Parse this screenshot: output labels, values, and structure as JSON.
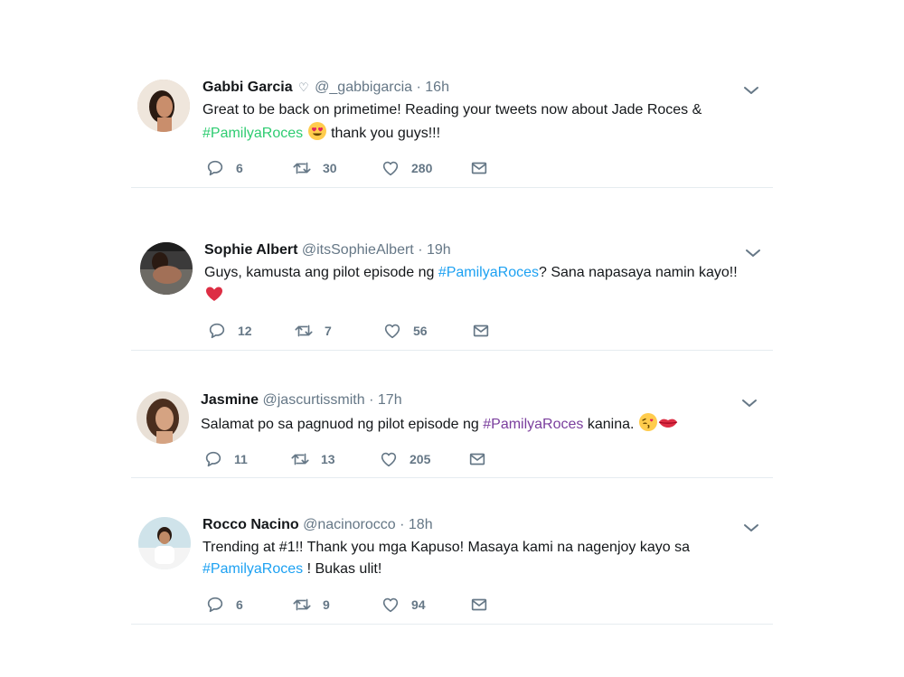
{
  "tweets": [
    {
      "name": "Gabbi Garcia",
      "verified_heart": "♡",
      "handle": "@_gabbigarcia",
      "time": "16h",
      "line1": "Great to be back on primetime! Reading your tweets now about Jade Roces &",
      "hashtag": "#PamilyaRoces",
      "after": "thank you guys!!!",
      "replies": "6",
      "retweets": "30",
      "likes": "280"
    },
    {
      "name": "Sophie Albert",
      "handle": "@itsSophieAlbert",
      "time": "19h",
      "before": "Guys, kamusta ang pilot episode ng",
      "hashtag": "#PamilyaRoces",
      "after": "? Sana napasaya namin kayo!!",
      "replies": "12",
      "retweets": "7",
      "likes": "56"
    },
    {
      "name": "Jasmine",
      "handle": "@jascurtissmith",
      "time": "17h",
      "before": "Salamat po sa pagnuod ng pilot episode ng",
      "hashtag": "#PamilyaRoces",
      "after": "kanina.",
      "replies": "11",
      "retweets": "13",
      "likes": "205"
    },
    {
      "name": "Rocco Nacino",
      "handle": "@nacinorocco",
      "time": "18h",
      "line1": "Trending at #1!! Thank you mga Kapuso! Masaya kami na nagenjoy kayo sa",
      "hashtag": "#PamilyaRoces",
      "after": "! Bukas ulit!",
      "replies": "6",
      "retweets": "9",
      "likes": "94"
    }
  ],
  "separator": "·",
  "colors": {
    "hashtag_green": "#2ecc71",
    "hashtag_blue": "#1da1f2",
    "hashtag_purple": "#7a3e9d",
    "icon_gray": "#657786"
  },
  "icons": [
    "reply-icon",
    "retweet-icon",
    "like-icon",
    "dm-icon",
    "chevron-down-icon"
  ]
}
